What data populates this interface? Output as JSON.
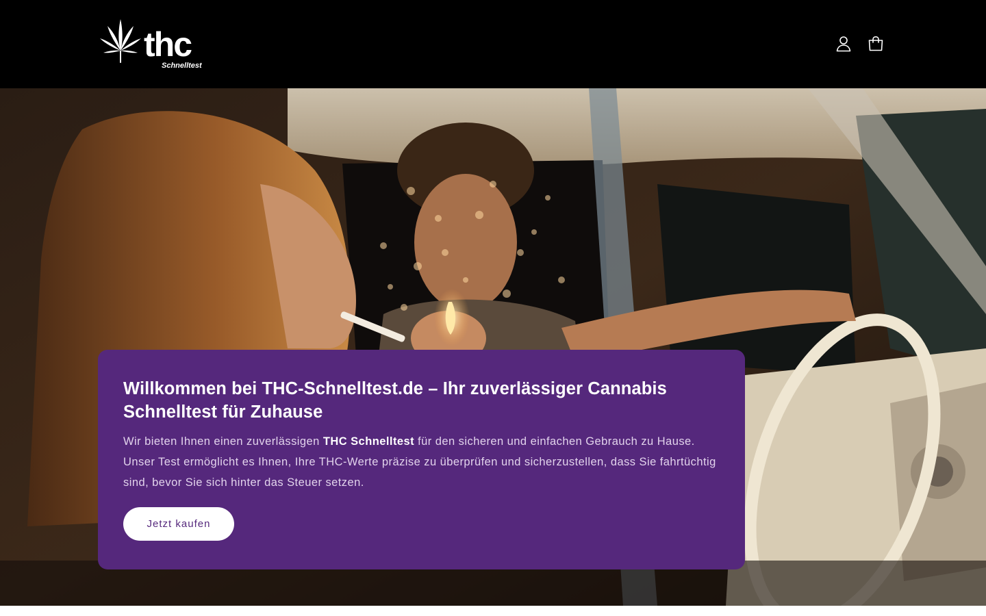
{
  "header": {
    "logo": {
      "name": "thc-schnelltest-logo",
      "wordmark": "thc",
      "tagline": "Schnelltest"
    },
    "account_icon": "account-icon",
    "cart_icon": "cart-icon"
  },
  "hero": {
    "image": "hero-photo-couple-in-car",
    "banner": {
      "heading": "Willkommen bei THC-Schnelltest.de – Ihr zuverlässiger Cannabis Schnelltest für Zuhause",
      "text_before": "Wir bieten Ihnen einen zuverlässigen ",
      "text_strong": "THC Schnelltest",
      "text_after": " für den sicheren und einfachen Gebrauch zu Hause. Unser Test ermöglicht es Ihnen, Ihre THC-Werte präzise zu überprüfen und sicherzustellen, dass Sie fahrtüchtig sind, bevor Sie sich hinter das Steuer setzen.",
      "cta_label": "Jetzt kaufen"
    }
  },
  "colors": {
    "header_bg": "#000000",
    "banner_bg": "#55287c",
    "cta_bg": "#ffffff",
    "cta_text": "#55287c"
  }
}
